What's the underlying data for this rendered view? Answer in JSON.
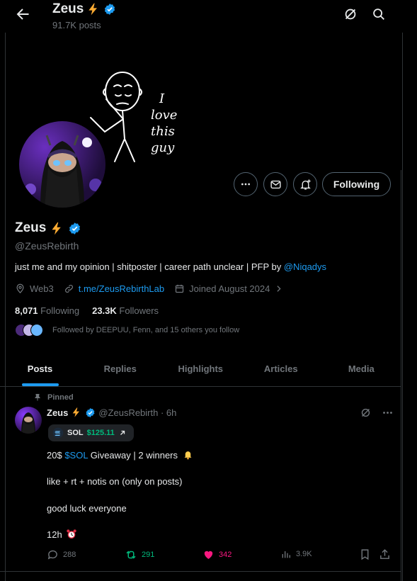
{
  "header": {
    "name": "Zeus",
    "posts_count": "91.7K posts"
  },
  "banner": {
    "drawing_text_lines": [
      "I",
      "love",
      "this",
      "guy"
    ]
  },
  "profile": {
    "name": "Zeus",
    "handle": "@ZeusRebirth",
    "bio_text": "just me and my opinion | shitposter | career path unclear | PFP by ",
    "bio_mention": "@Niqadys",
    "location": "Web3",
    "link": "t.me/ZeusRebirthLab",
    "joined": "Joined August 2024",
    "following_count": "8,071",
    "following_label": "Following",
    "followers_count": "23.3K",
    "followers_label": "Followers",
    "followed_by": "Followed by DEEPUU, Fenn, and 15 others you follow",
    "follow_button": "Following"
  },
  "tabs": [
    "Posts",
    "Replies",
    "Highlights",
    "Articles",
    "Media"
  ],
  "post": {
    "pinned_label": "Pinned",
    "name": "Zeus",
    "handle_time": "@ZeusRebirth · 6h",
    "chip_symbol": "SOL",
    "chip_price": "$125.11",
    "line1_prefix": "20$ ",
    "line1_tag": "$SOL",
    "line1_suffix": " Giveaway | 2 winners",
    "line2": "like + rt + notis on (only on posts)",
    "line3": "good luck everyone",
    "line4": "12h",
    "replies": "288",
    "reposts": "291",
    "likes": "342",
    "views": "3.9K"
  },
  "colors": {
    "accent": "#1d9bf0",
    "repost": "#00ba7c",
    "like": "#f91880",
    "verified": "#1d9bf0",
    "lightning": "#ffac33"
  },
  "icons": [
    "back-arrow-icon",
    "grok-icon",
    "search-icon",
    "more-icon",
    "message-icon",
    "notification-add-icon",
    "verified-icon",
    "lightning-icon",
    "location-icon",
    "link-icon",
    "calendar-icon",
    "pin-icon",
    "reply-icon",
    "repost-icon",
    "like-icon",
    "views-icon",
    "bookmark-icon",
    "share-icon",
    "bell-emoji-icon",
    "alarm-clock-icon"
  ]
}
